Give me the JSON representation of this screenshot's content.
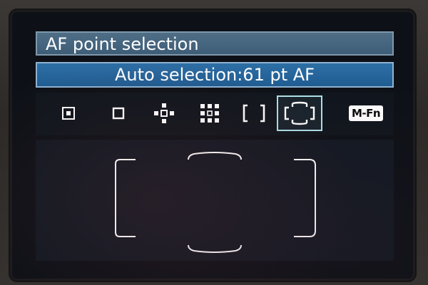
{
  "screen": {
    "title": "AF point selection",
    "mode_label": "Auto selection:61 pt AF"
  },
  "af_modes": {
    "items": [
      {
        "icon": "spot-af-icon"
      },
      {
        "icon": "single-point-af-icon"
      },
      {
        "icon": "expansion-4-points-af-icon"
      },
      {
        "icon": "expansion-surround-af-icon"
      },
      {
        "icon": "zone-af-icon"
      },
      {
        "icon": "auto-selection-61pt-af-icon",
        "selected": true
      }
    ],
    "mfn_label": "M-Fn"
  },
  "colors": {
    "title_bar": "#46657e",
    "mode_bar": "#26669c",
    "selection_border": "#aee3ea",
    "icon_white": "#ffffff"
  }
}
